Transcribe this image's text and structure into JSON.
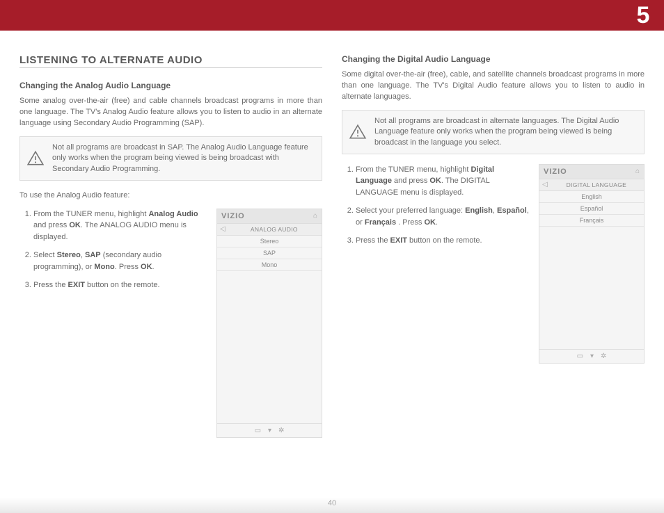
{
  "chapter_number": "5",
  "page_number": "40",
  "left": {
    "section_title": "LISTENING TO ALTERNATE AUDIO",
    "sub_heading": "Changing the Analog Audio Language",
    "intro": "Some analog over-the-air (free) and cable channels broadcast programs in more than one language. The TV's Analog Audio feature allows you to listen to audio in an alternate language using Secondary Audio Programming (SAP).",
    "note": "Not all programs are broadcast in SAP. The Analog Audio Language feature only works when the program being viewed is being broadcast with Secondary Audio Programming.",
    "lead_in": "To use the Analog Audio feature:",
    "steps": {
      "s1_a": "From the TUNER menu, highlight ",
      "s1_b1": "Analog Audio",
      "s1_c": " and press ",
      "s1_b2": "OK",
      "s1_d": ". The ANALOG AUDIO menu is displayed.",
      "s2_a": "Select ",
      "s2_b1": "Stereo",
      "s2_c": ", ",
      "s2_b2": "SAP",
      "s2_d": " (secondary audio programming), or ",
      "s2_b3": "Mono",
      "s2_e": ". Press ",
      "s2_b4": "OK",
      "s2_f": ".",
      "s3_a": "Press the ",
      "s3_b": "EXIT",
      "s3_c": " button on the remote."
    },
    "menu": {
      "logo": "VIZIO",
      "title": "ANALOG AUDIO",
      "rows": [
        "Stereo",
        "SAP",
        "Mono"
      ]
    }
  },
  "right": {
    "sub_heading": "Changing the Digital Audio Language",
    "intro": "Some digital over-the-air (free), cable, and satellite channels broadcast programs in more than one language. The TV's Digital Audio feature allows you to listen to audio in alternate languages.",
    "note": "Not all programs are broadcast in alternate languages. The Digital Audio Language feature only works when the program being viewed is being broadcast in the language you select.",
    "steps": {
      "s1_a": "From the TUNER menu, highlight ",
      "s1_b1": "Digital Language",
      "s1_c": " and press ",
      "s1_b2": "OK",
      "s1_d": ". The DIGITAL LANGUAGE menu is displayed.",
      "s2_a": "Select your preferred language: ",
      "s2_b1": "English",
      "s2_c": ", ",
      "s2_b2": "Español",
      "s2_d": ",  or ",
      "s2_b3": "Français",
      "s2_e": " . Press ",
      "s2_b4": "OK",
      "s2_f": ".",
      "s3_a": "Press the ",
      "s3_b": "EXIT",
      "s3_c": " button on the remote."
    },
    "menu": {
      "logo": "VIZIO",
      "title": "DIGITAL LANGUAGE",
      "rows": [
        "English",
        "Español",
        "Français"
      ]
    }
  },
  "icons": {
    "home": "⌂",
    "back": "◁",
    "wide": "▭",
    "down": "▾",
    "gear": "✲"
  }
}
